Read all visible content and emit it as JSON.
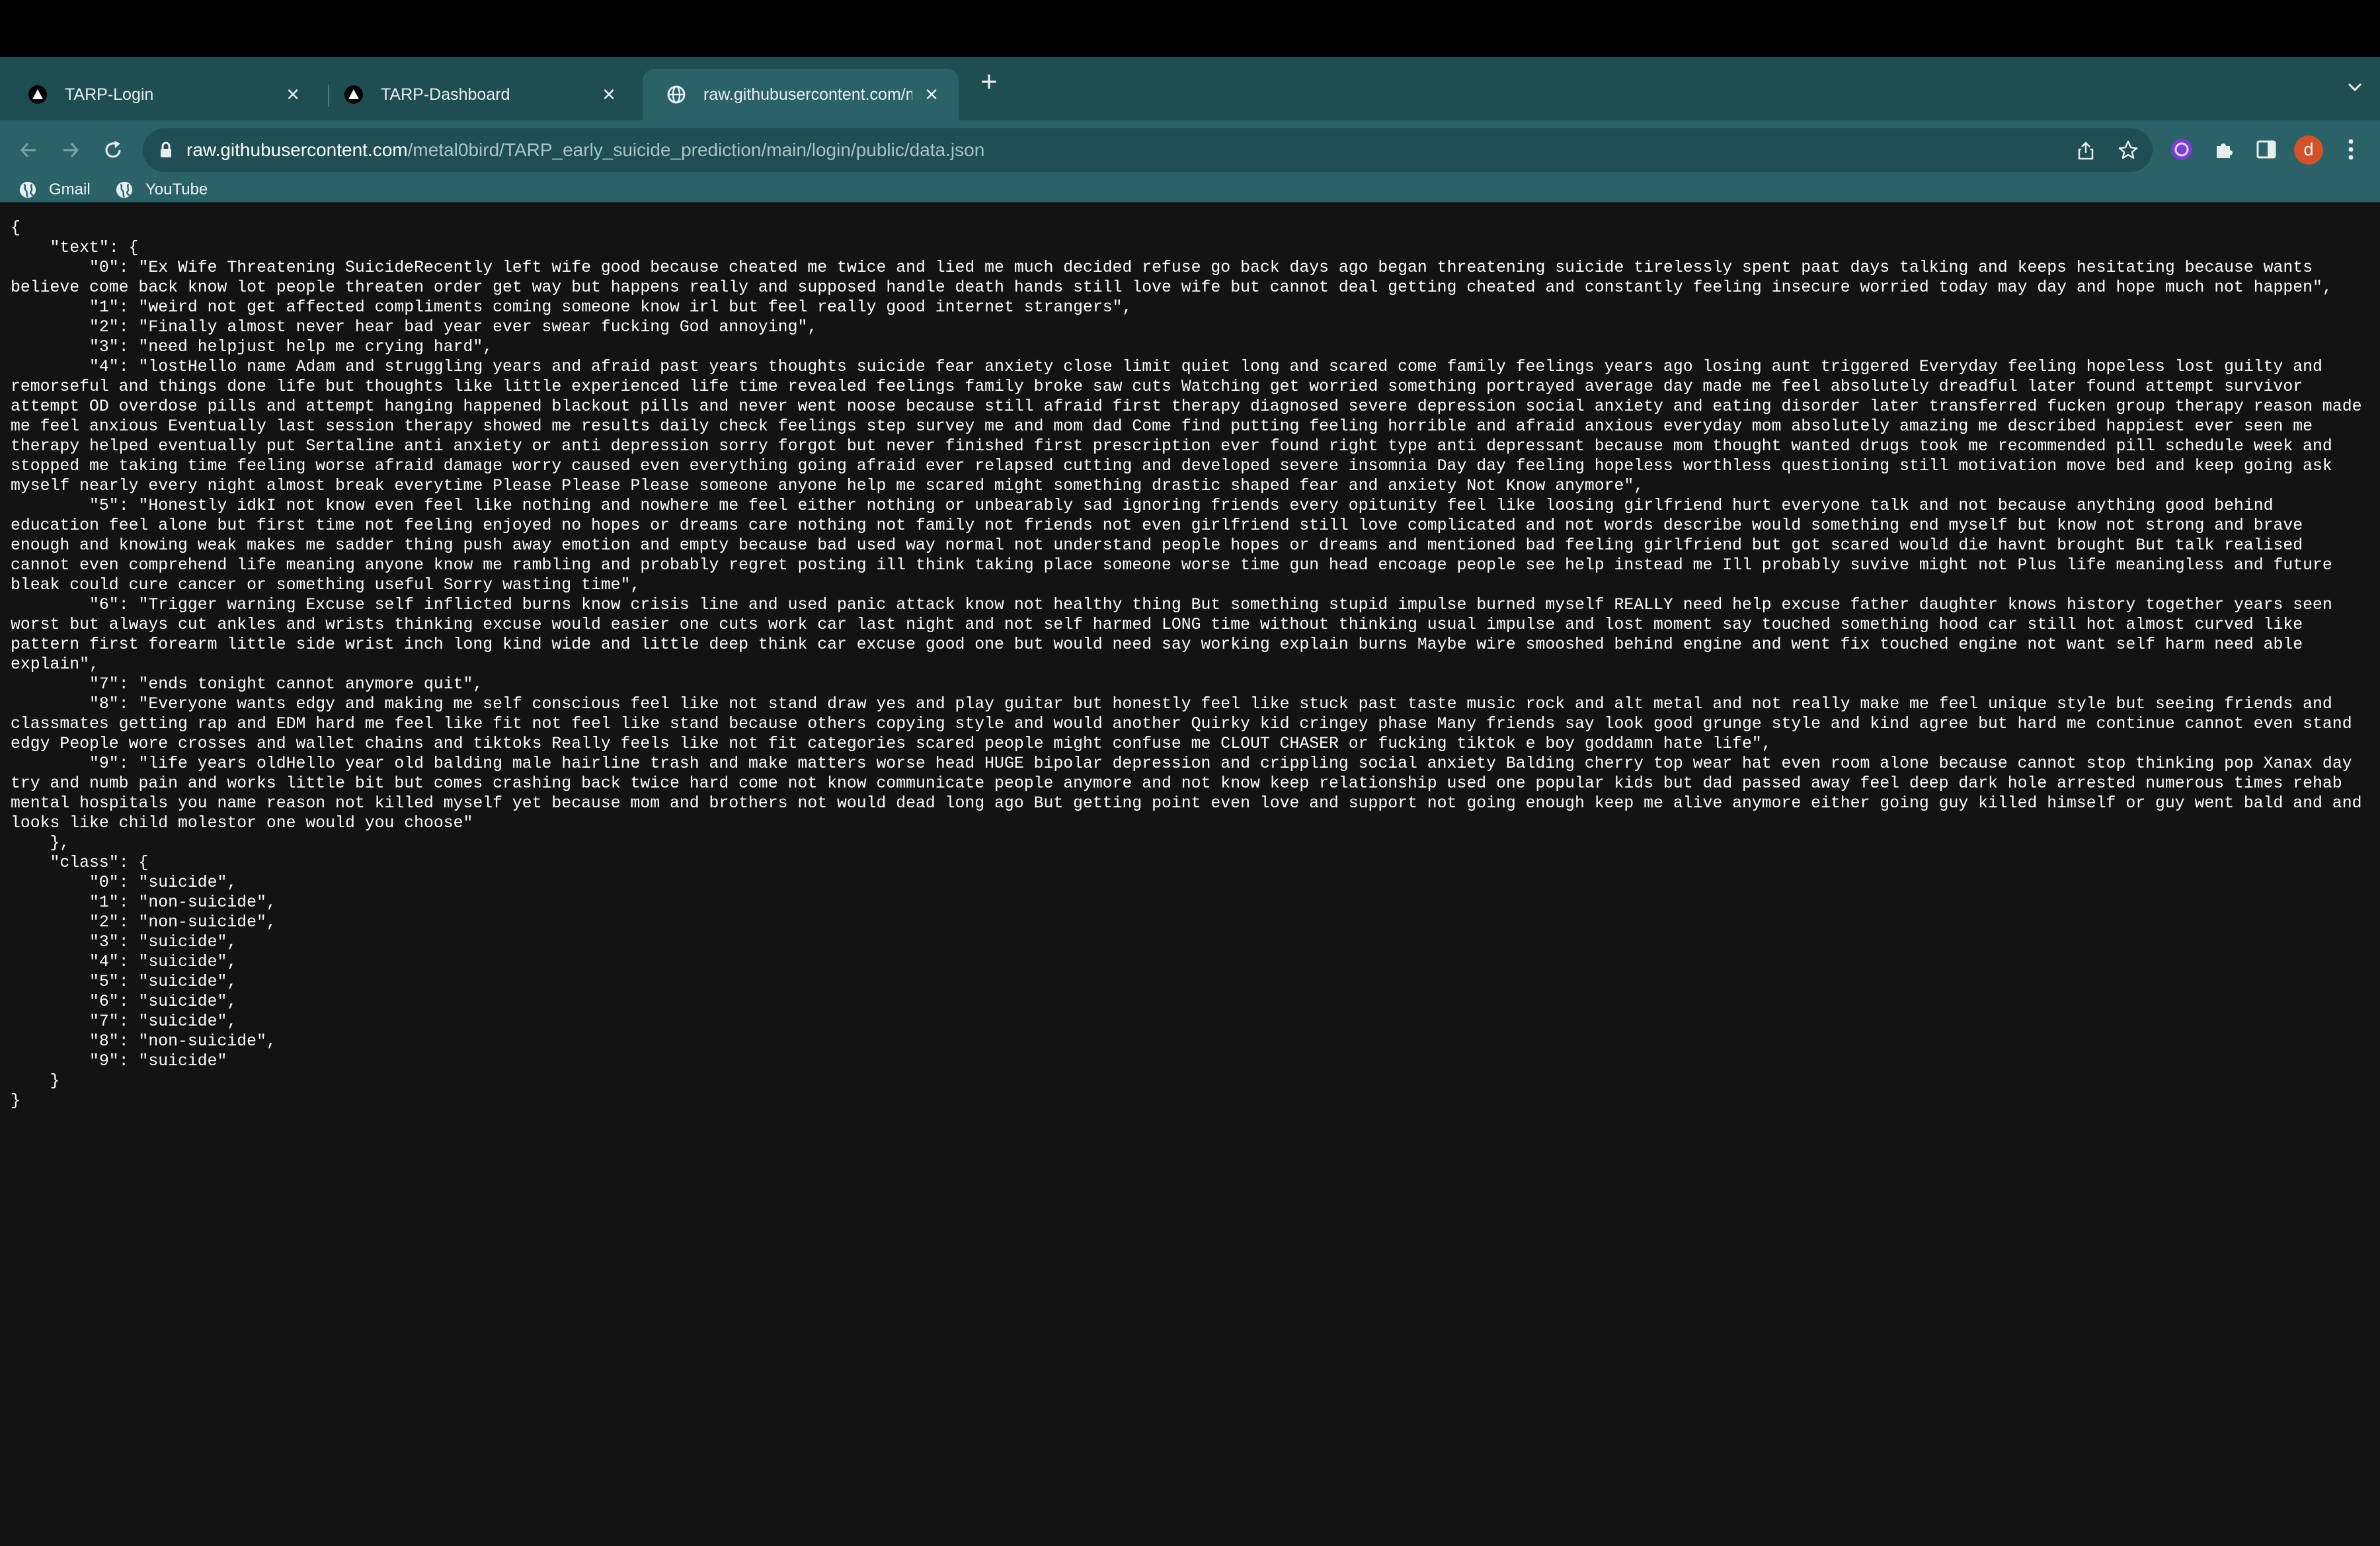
{
  "browser": {
    "tabs": [
      {
        "title": "TARP-Login",
        "active": false,
        "icon": "triangle-logo-icon"
      },
      {
        "title": "TARP-Dashboard",
        "active": false,
        "icon": "triangle-logo-icon"
      },
      {
        "title": "raw.githubusercontent.com/me",
        "active": true,
        "icon": "globe-icon"
      }
    ],
    "address": {
      "host": "raw.githubusercontent.com",
      "path": "/metal0bird/TARP_early_suicide_prediction/main/login/public/data.json"
    },
    "profile_initial": "d",
    "bookmarks": [
      {
        "label": "Gmail",
        "icon": "globe-icon"
      },
      {
        "label": "YouTube",
        "icon": "globe-icon"
      }
    ],
    "colors": {
      "tabstrip": "#1e4d52",
      "toolbar": "#2a6268",
      "page_background": "#131313",
      "avatar": "#d2512b"
    }
  },
  "page": {
    "json_text": "{\n    \"text\": {\n        \"0\": \"Ex Wife Threatening SuicideRecently left wife good because cheated me twice and lied me much decided refuse go back days ago began threatening suicide tirelessly spent paat days talking and keeps hesitating because wants believe come back know lot people threaten order get way but happens really and supposed handle death hands still love wife but cannot deal getting cheated and constantly feeling insecure worried today may day and hope much not happen\",\n        \"1\": \"weird not get affected compliments coming someone know irl but feel really good internet strangers\",\n        \"2\": \"Finally almost never hear bad year ever swear fucking God annoying\",\n        \"3\": \"need helpjust help me crying hard\",\n        \"4\": \"lostHello name Adam and struggling years and afraid past years thoughts suicide fear anxiety close limit quiet long and scared come family feelings years ago losing aunt triggered Everyday feeling hopeless lost guilty and remorseful and things done life but thoughts like little experienced life time revealed feelings family broke saw cuts Watching get worried something portrayed average day made me feel absolutely dreadful later found attempt survivor attempt OD overdose pills and attempt hanging happened blackout pills and never went noose because still afraid first therapy diagnosed severe depression social anxiety and eating disorder later transferred fucken group therapy reason made me feel anxious Eventually last session therapy showed me results daily check feelings step survey me and mom dad Come find putting feeling horrible and afraid anxious everyday mom absolutely amazing me described happiest ever seen me therapy helped eventually put Sertaline anti anxiety or anti depression sorry forgot but never finished first prescription ever found right type anti depressant because mom thought wanted drugs took me recommended pill schedule week and stopped me taking time feeling worse afraid damage worry caused even everything going afraid ever relapsed cutting and developed severe insomnia Day day feeling hopeless worthless questioning still motivation move bed and keep going ask myself nearly every night almost break everytime Please Please Please someone anyone help me scared might something drastic shaped fear and anxiety Not Know anymore\",\n        \"5\": \"Honestly idkI not know even feel like nothing and nowhere me feel either nothing or unbearably sad ignoring friends every opitunity feel like loosing girlfriend hurt everyone talk and not because anything good behind education feel alone but first time not feeling enjoyed no hopes or dreams care nothing not family not friends not even girlfriend still love complicated and not words describe would something end myself but know not strong and brave enough and knowing weak makes me sadder thing push away emotion and empty because bad used way normal not understand people hopes or dreams and mentioned bad feeling girlfriend but got scared would die havnt brought But talk realised cannot even comprehend life meaning anyone know me rambling and probably regret posting ill think taking place someone worse time gun head encoage people see help instead me Ill probably suvive might not Plus life meaningless and future bleak could cure cancer or something useful Sorry wasting time\",\n        \"6\": \"Trigger warning Excuse self inflicted burns know crisis line and used panic attack know not healthy thing But something stupid impulse burned myself REALLY need help excuse father daughter knows history together years seen worst but always cut ankles and wrists thinking excuse would easier one cuts work car last night and not self harmed LONG time without thinking usual impulse and lost moment say touched something hood car still hot almost curved like pattern first forearm little side wrist inch long kind wide and little deep think car excuse good one but would need say working explain burns Maybe wire smooshed behind engine and went fix touched engine not want self harm need able explain\",\n        \"7\": \"ends tonight cannot anymore quit\",\n        \"8\": \"Everyone wants edgy and making me self conscious feel like not stand draw yes and play guitar but honestly feel like stuck past taste music rock and alt metal and not really make me feel unique style but seeing friends and classmates getting rap and EDM hard me feel like fit not feel like stand because others copying style and would another Quirky kid cringey phase Many friends say look good grunge style and kind agree but hard me continue cannot even stand edgy People wore crosses and wallet chains and tiktoks Really feels like not fit categories scared people might confuse me CLOUT CHASER or fucking tiktok e boy goddamn hate life\",\n        \"9\": \"life years oldHello year old balding male hairline trash and make matters worse head HUGE bipolar depression and crippling social anxiety Balding cherry top wear hat even room alone because cannot stop thinking pop Xanax day try and numb pain and works little bit but comes crashing back twice hard come not know communicate people anymore and not know keep relationship used one popular kids but dad passed away feel deep dark hole arrested numerous times rehab mental hospitals you name reason not killed myself yet because mom and brothers not would dead long ago But getting point even love and support not going enough keep me alive anymore either going guy killed himself or guy went bald and and looks like child molestor one would you choose\"\n    },\n    \"class\": {\n        \"0\": \"suicide\",\n        \"1\": \"non-suicide\",\n        \"2\": \"non-suicide\",\n        \"3\": \"suicide\",\n        \"4\": \"suicide\",\n        \"5\": \"suicide\",\n        \"6\": \"suicide\",\n        \"7\": \"suicide\",\n        \"8\": \"non-suicide\",\n        \"9\": \"suicide\"\n    }\n}"
  }
}
